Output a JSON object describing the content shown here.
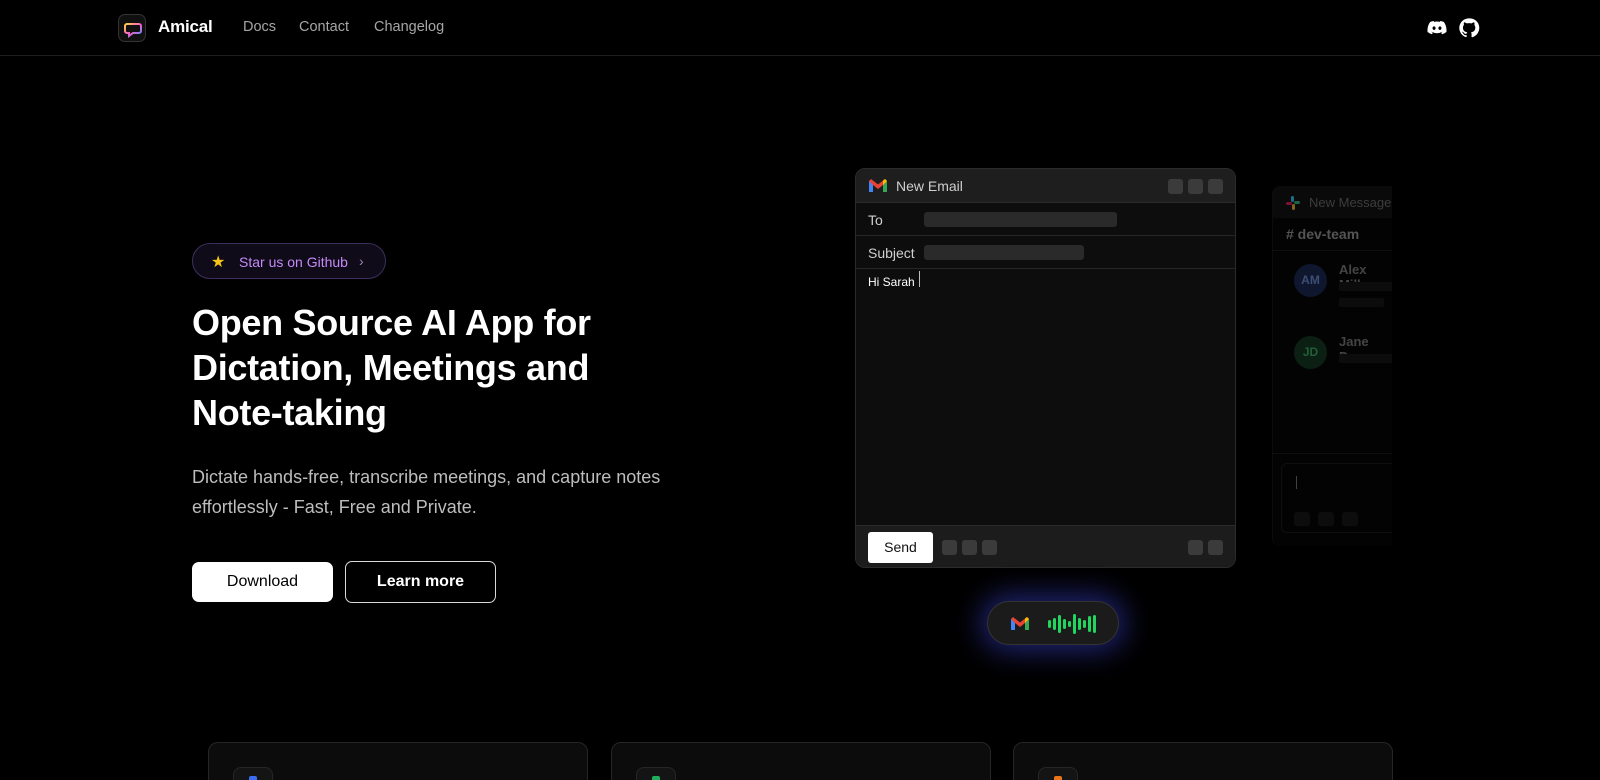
{
  "nav": {
    "brand": "Amical",
    "links": [
      "Docs",
      "Contact",
      "Changelog"
    ],
    "icons": [
      "discord-icon",
      "github-icon"
    ]
  },
  "hero": {
    "star_pill": {
      "icon": "star-icon",
      "label": "Star us on Github",
      "chevron": "›"
    },
    "headline": "Open Source AI App for Dictation, Meetings and Note-taking",
    "subtext": "Dictate hands-free, transcribe meetings, and capture notes effortlessly - Fast, Free and Private.",
    "download_label": "Download",
    "learn_more_label": "Learn more"
  },
  "email_window": {
    "app_icon": "gmail-icon",
    "title": "New Email",
    "to_label": "To",
    "subject_label": "Subject",
    "body_text": "Hi Sarah",
    "send_label": "Send"
  },
  "slack_window": {
    "app_icon": "slack-icon",
    "title": "New Message",
    "channel": "# dev-team",
    "messages": [
      {
        "initials": "AM",
        "name": "Alex Miller"
      },
      {
        "initials": "JD",
        "name": "Jane Doe"
      }
    ]
  },
  "colors": {
    "accent_purple": "#c58af9",
    "wave_green": "#1fd65f",
    "glow_blue": "#4650ff"
  }
}
